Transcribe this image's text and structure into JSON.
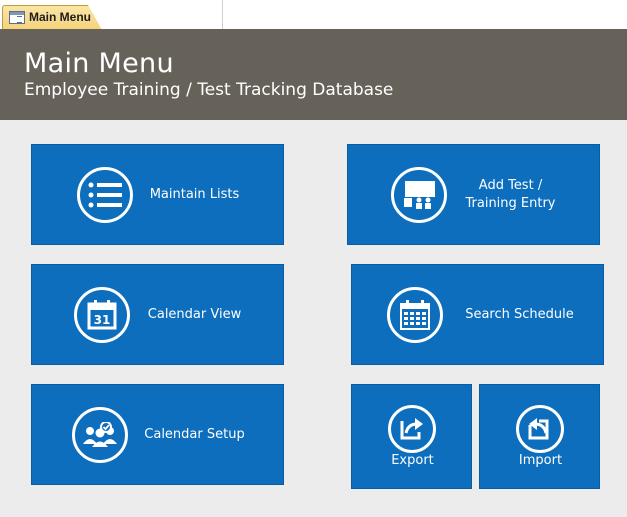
{
  "tab": {
    "label": "Main Menu"
  },
  "header": {
    "title": "Main Menu",
    "subtitle": "Employee Training / Test Tracking Database"
  },
  "buttons": {
    "maintain_lists": "Maintain Lists",
    "add_test": "Add Test /\nTraining Entry",
    "calendar_view": "Calendar View",
    "search_schedule": "Search Schedule",
    "calendar_setup": "Calendar Setup",
    "export": "Export",
    "import": "Import"
  },
  "icons": {
    "maintain_lists": "list-icon",
    "add_test": "presentation-icon",
    "calendar_view": "calendar-31-icon",
    "search_schedule": "calendar-grid-icon",
    "calendar_setup": "group-settings-icon",
    "export": "export-arrow-icon",
    "import": "import-arrow-icon"
  },
  "colors": {
    "header_bg": "#676259",
    "button_bg": "#0c6ebd",
    "background": "#ececec"
  }
}
